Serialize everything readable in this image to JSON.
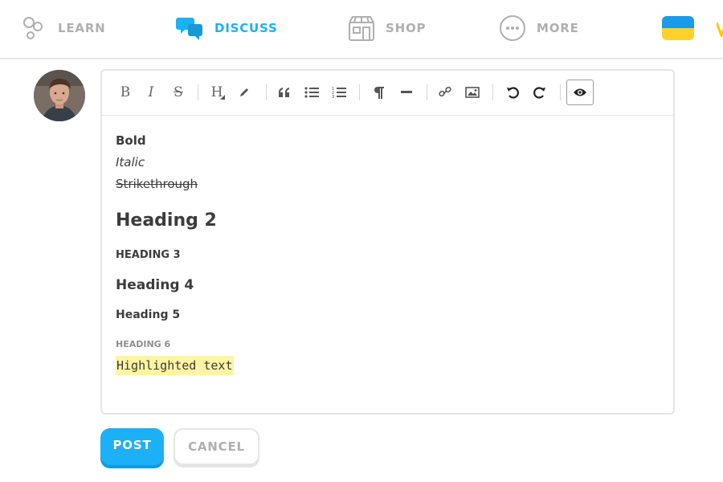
{
  "nav": {
    "learn": {
      "label": "LEARN",
      "icon": "learn-path-icon"
    },
    "discuss": {
      "label": "DISCUSS",
      "icon": "chat-bubbles-icon"
    },
    "shop": {
      "label": "SHOP",
      "icon": "shop-icon"
    },
    "more": {
      "label": "MORE",
      "icon": "more-dots-icon"
    },
    "flag": {
      "icon": "ukraine-flag-icon",
      "colors": [
        "#1a9be8",
        "#ffd12a"
      ]
    }
  },
  "editor": {
    "toolbar": {
      "bold": "B",
      "italic": "I",
      "strikethrough": "S",
      "heading": "H"
    },
    "content": {
      "bold": "Bold",
      "italic": "Italic",
      "strikethrough": "Strikethrough",
      "heading2": "Heading 2",
      "heading3": "HEADING 3",
      "heading4": "Heading 4",
      "heading5": "Heading 5",
      "heading6": "HEADING 6",
      "highlighted": "Highlighted text"
    }
  },
  "actions": {
    "post": "POST",
    "cancel": "CANCEL"
  },
  "colors": {
    "accent": "#1cb0f6",
    "highlight": "#fff4a3",
    "muted": "#afafaf"
  }
}
